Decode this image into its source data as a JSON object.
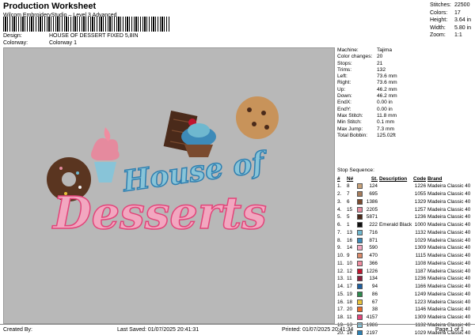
{
  "header": {
    "title": "Production Worksheet",
    "subtitle": "Wilcom EmbroideryStudio – Level 3 Advanced",
    "design_label": "Design:",
    "design_value": "HOUSE OF DESSERT FIXED 5,8IN",
    "colorway_label": "Colorway:",
    "colorway_value": "Colorway 1"
  },
  "summary": [
    {
      "k": "Stitches:",
      "v": "22500"
    },
    {
      "k": "Colors:",
      "v": "17"
    },
    {
      "k": "Height:",
      "v": "3.64 in"
    },
    {
      "k": "Width:",
      "v": "5.80 in"
    },
    {
      "k": "Zoom:",
      "v": "1:1"
    }
  ],
  "specs": [
    {
      "k": "Machine:",
      "v": "Tajima"
    },
    {
      "k": "Color changes:",
      "v": "20"
    },
    {
      "k": "Stops:",
      "v": "21"
    },
    {
      "k": "Trims:",
      "v": "132"
    },
    {
      "k": "Left:",
      "v": "73.6 mm"
    },
    {
      "k": "Right:",
      "v": "73.6 mm"
    },
    {
      "k": "Up:",
      "v": "46.2 mm"
    },
    {
      "k": "Down:",
      "v": "46.2 mm"
    },
    {
      "k": "EndX:",
      "v": "0.00 in"
    },
    {
      "k": "EndY:",
      "v": "0.00 in"
    },
    {
      "k": "Max Stitch:",
      "v": "11.8 mm"
    },
    {
      "k": "Min Stitch:",
      "v": "0.1 mm"
    },
    {
      "k": "Max Jump:",
      "v": "7.3 mm"
    },
    {
      "k": "Total Bobbin:",
      "v": "125.02ft"
    }
  ],
  "stop_sequence_title": "Stop Sequence:",
  "columns": [
    "#",
    "N#",
    "",
    "St.",
    "Description",
    "Code",
    "Brand"
  ],
  "stops": [
    {
      "num": "1.",
      "n": "8",
      "color": "#c8a27a",
      "st": "124",
      "desc": "",
      "code": "1226",
      "brand": "Madeira Classic 40"
    },
    {
      "num": "2.",
      "n": "7",
      "color": "#a67c5b",
      "st": "695",
      "desc": "",
      "code": "1055",
      "brand": "Madeira Classic 40"
    },
    {
      "num": "3.",
      "n": "6",
      "color": "#7a4a2e",
      "st": "1386",
      "desc": "",
      "code": "1329",
      "brand": "Madeira Classic 40"
    },
    {
      "num": "4.",
      "n": "15",
      "color": "#e58a9e",
      "st": "2205",
      "desc": "",
      "code": "1257",
      "brand": "Madeira Classic 40"
    },
    {
      "num": "5.",
      "n": "5",
      "color": "#4a2a1a",
      "st": "5871",
      "desc": "",
      "code": "1236",
      "brand": "Madeira Classic 40"
    },
    {
      "num": "6.",
      "n": "1",
      "color": "#111111",
      "st": "222",
      "desc": "Emerald Black",
      "code": "1000",
      "brand": "Madeira Classic 40"
    },
    {
      "num": "7.",
      "n": "13",
      "color": "#6fb8cf",
      "st": "716",
      "desc": "",
      "code": "1132",
      "brand": "Madeira Classic 40"
    },
    {
      "num": "8.",
      "n": "16",
      "color": "#3d8ab8",
      "st": "871",
      "desc": "",
      "code": "1029",
      "brand": "Madeira Classic 40"
    },
    {
      "num": "9.",
      "n": "14",
      "color": "#f2a7c0",
      "st": "590",
      "desc": "",
      "code": "1309",
      "brand": "Madeira Classic 40"
    },
    {
      "num": "10.",
      "n": "9",
      "color": "#d98a6a",
      "st": "470",
      "desc": "",
      "code": "1115",
      "brand": "Madeira Classic 40"
    },
    {
      "num": "11.",
      "n": "10",
      "color": "#f08ca0",
      "st": "366",
      "desc": "",
      "code": "1108",
      "brand": "Madeira Classic 40"
    },
    {
      "num": "12.",
      "n": "12",
      "color": "#c0152f",
      "st": "1226",
      "desc": "",
      "code": "1187",
      "brand": "Madeira Classic 40"
    },
    {
      "num": "13.",
      "n": "11",
      "color": "#8a1f3c",
      "st": "134",
      "desc": "",
      "code": "1236",
      "brand": "Madeira Classic 40"
    },
    {
      "num": "14.",
      "n": "17",
      "color": "#1f5fa0",
      "st": "94",
      "desc": "",
      "code": "1166",
      "brand": "Madeira Classic 40"
    },
    {
      "num": "15.",
      "n": "19",
      "color": "#2e8a4e",
      "st": "86",
      "desc": "",
      "code": "1249",
      "brand": "Madeira Classic 40"
    },
    {
      "num": "16.",
      "n": "18",
      "color": "#e8c23a",
      "st": "67",
      "desc": "",
      "code": "1223",
      "brand": "Madeira Classic 40"
    },
    {
      "num": "17.",
      "n": "20",
      "color": "#e86a2a",
      "st": "38",
      "desc": "",
      "code": "1146",
      "brand": "Madeira Classic 40"
    },
    {
      "num": "18.",
      "n": "11",
      "color": "#e2457a",
      "st": "4157",
      "desc": "",
      "code": "1309",
      "brand": "Madeira Classic 40"
    },
    {
      "num": "19.",
      "n": "13",
      "color": "#88c4d8",
      "st": "1986",
      "desc": "",
      "code": "1132",
      "brand": "Madeira Classic 40"
    },
    {
      "num": "20.",
      "n": "16",
      "color": "#2f7fb0",
      "st": "2197",
      "desc": "",
      "code": "1029",
      "brand": "Madeira Classic 40"
    },
    {
      "num": "21.",
      "n": "3",
      "color": "#f4f4f4",
      "st": "1197",
      "desc": "Natural White",
      "code": "1004",
      "brand": "Madeira Classic 40"
    }
  ],
  "design_text": {
    "line1": "House of",
    "line2": "Desserts"
  },
  "footer": {
    "created": "Created By:",
    "saved": "Last Saved: 01/07/2025 20:41:31",
    "printed": "Printed: 01/07/2025 20:41:34",
    "page": "Page 1 of 1"
  }
}
